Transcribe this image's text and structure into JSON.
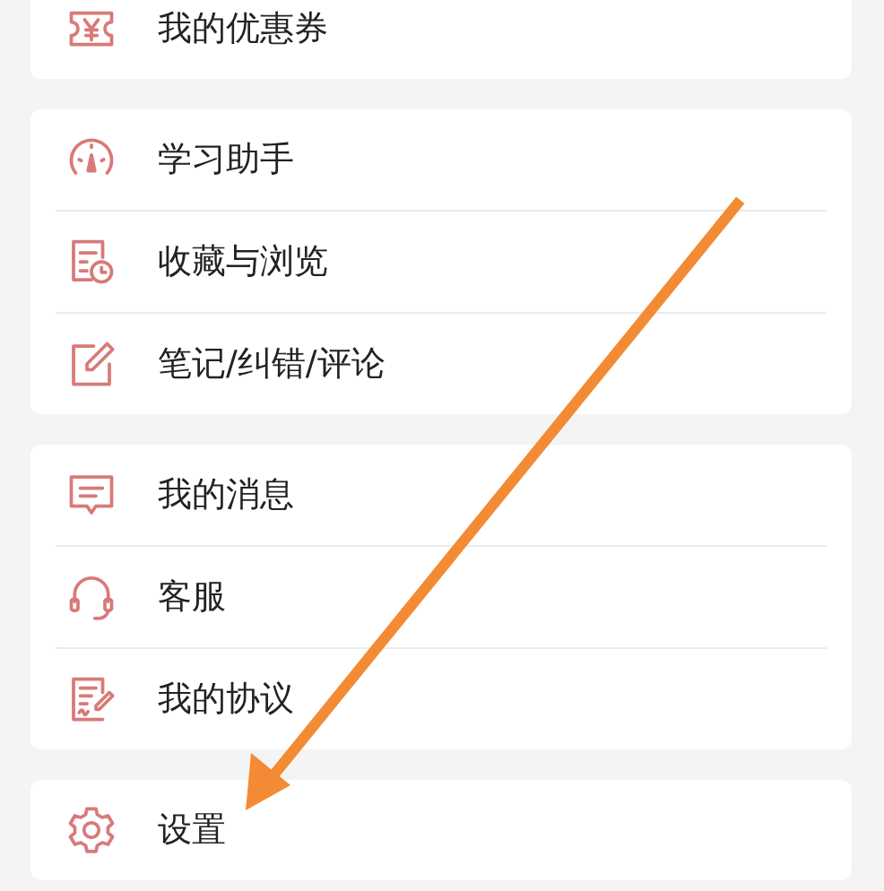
{
  "groups": [
    {
      "items": [
        {
          "label": "我的优惠券",
          "kind": "ticket"
        }
      ]
    },
    {
      "items": [
        {
          "label": "学习助手",
          "kind": "gauge"
        },
        {
          "label": "收藏与浏览",
          "kind": "history"
        },
        {
          "label": "笔记/纠错/评论",
          "kind": "edit"
        }
      ]
    },
    {
      "items": [
        {
          "label": "我的消息",
          "kind": "message"
        },
        {
          "label": "客服",
          "kind": "headset"
        },
        {
          "label": "我的协议",
          "kind": "document"
        }
      ]
    },
    {
      "items": [
        {
          "label": "设置",
          "kind": "gear"
        }
      ]
    }
  ],
  "annotation": {
    "kind": "arrow"
  }
}
